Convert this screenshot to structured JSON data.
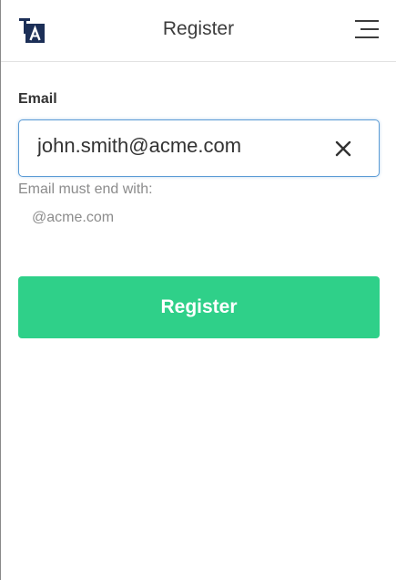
{
  "header": {
    "logo_text": "TA",
    "title": "Register",
    "menu_icon": "hamburger-icon"
  },
  "form": {
    "email_label": "Email",
    "email_value": "john.smith@acme.com",
    "clear_icon": "close-icon",
    "hint_title": "Email must end with:",
    "hint_domain": "@acme.com",
    "submit_label": "Register"
  },
  "colors": {
    "accent_button": "#2fd089",
    "input_focus_border": "#5b9bd5",
    "logo_navy": "#1c2f57",
    "hint_text": "#8c8c8c"
  }
}
